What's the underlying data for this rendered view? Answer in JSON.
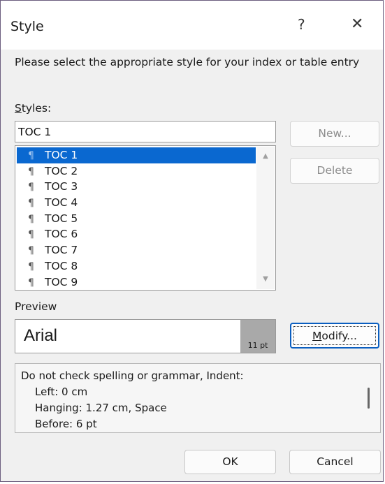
{
  "window": {
    "title": "Style",
    "help_label": "?",
    "close_label": "✕"
  },
  "instruction": "Please select the appropriate style for your index or table entry",
  "styles": {
    "label_accel": "S",
    "label_rest": "tyles:",
    "current_value": "TOC 1",
    "items": [
      {
        "label": "TOC 1",
        "selected": true
      },
      {
        "label": "TOC 2",
        "selected": false
      },
      {
        "label": "TOC 3",
        "selected": false
      },
      {
        "label": "TOC 4",
        "selected": false
      },
      {
        "label": "TOC 5",
        "selected": false
      },
      {
        "label": "TOC 6",
        "selected": false
      },
      {
        "label": "TOC 7",
        "selected": false
      },
      {
        "label": "TOC 8",
        "selected": false
      },
      {
        "label": "TOC 9",
        "selected": false
      }
    ],
    "pilcrow_glyph": "¶"
  },
  "buttons": {
    "new": "New...",
    "delete": "Delete",
    "modify_accel": "M",
    "modify_rest": "odify...",
    "ok": "OK",
    "cancel": "Cancel"
  },
  "preview": {
    "label": "Preview",
    "font_name": "Arial",
    "font_size": "11 pt"
  },
  "description": {
    "line1": "Do not check spelling or grammar, Indent:",
    "line2": "Left:  0 cm",
    "line3": "Hanging:  1.27 cm, Space",
    "line4": "Before:  6 pt"
  },
  "colors": {
    "selection": "#0a68d0",
    "dialog_bg": "#f0f0f0",
    "focus_border": "#0a5ec0"
  }
}
